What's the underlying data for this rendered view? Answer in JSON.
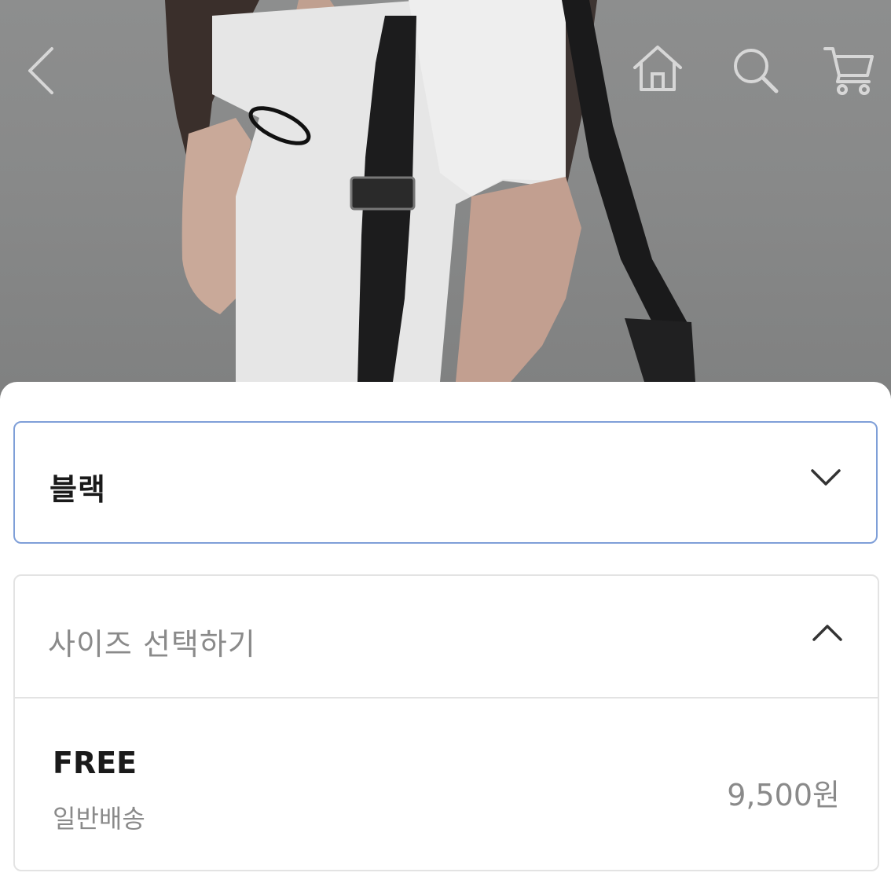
{
  "header": {
    "icons": {
      "back": "chevron-left-icon",
      "home": "home-icon",
      "search": "search-icon",
      "cart": "cart-icon"
    }
  },
  "options": {
    "color_select": {
      "selected_value": "블랙"
    },
    "size_select": {
      "placeholder": "사이즈 선택하기",
      "items": [
        {
          "name": "FREE",
          "shipping": "일반배송",
          "price": "9,500원"
        }
      ]
    }
  },
  "colors": {
    "select_border_active": "#7f9fd8",
    "panel_border": "#e3e3e3",
    "text_primary": "#1a1a1a",
    "text_secondary": "#8a8a8a"
  }
}
